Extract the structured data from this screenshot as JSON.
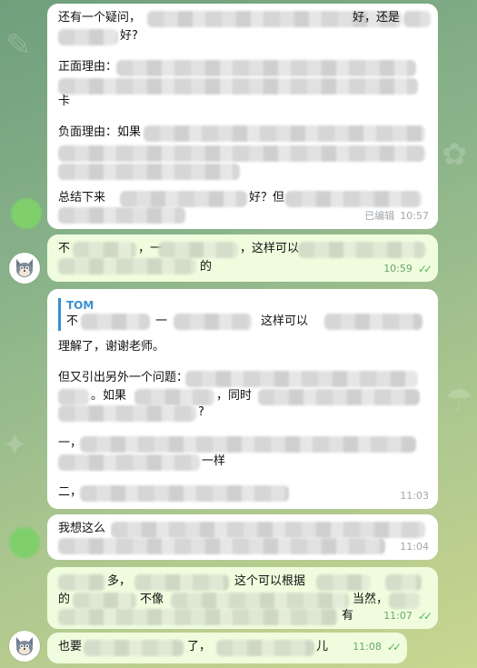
{
  "messages": [
    {
      "id": "m1",
      "lines": [
        "还有一个疑问，",
        "好，还是",
        "好?",
        "正面理由：",
        "卡",
        "负面理由：如果",
        "总结下来",
        "好？但"
      ],
      "status_label": "已编辑",
      "time": "10:57"
    },
    {
      "id": "m2",
      "lines": [
        "不",
        "，一",
        "，这样可以",
        "的"
      ],
      "time": "10:59"
    },
    {
      "id": "m3",
      "reply_name": "TOM",
      "reply_lines": [
        "不",
        "一",
        "这样可以"
      ],
      "lines": [
        "理解了，谢谢老师。",
        "但又引出另外一个问题：",
        "。如果",
        "，同时",
        "?",
        "一，",
        "一样",
        "二，"
      ],
      "time": "11:03"
    },
    {
      "id": "m4",
      "lines": [
        "我想这么"
      ],
      "time": "11:04"
    },
    {
      "id": "m5",
      "lines": [
        "多，",
        "这个可以根据",
        "的",
        "不像",
        "当然，",
        "有"
      ],
      "time": "11:07"
    },
    {
      "id": "m6",
      "lines": [
        "也要",
        "了，",
        "儿"
      ],
      "time": "11:08"
    }
  ],
  "colors": {
    "incoming_bubble": "#ffffff",
    "outgoing_bubble": "#effdde",
    "reply_accent": "#3a8fd0",
    "read_check": "#59b25c"
  },
  "icons": {
    "read_receipt": "double-check-icon",
    "avatar": "tom-cat-avatar-icon"
  }
}
